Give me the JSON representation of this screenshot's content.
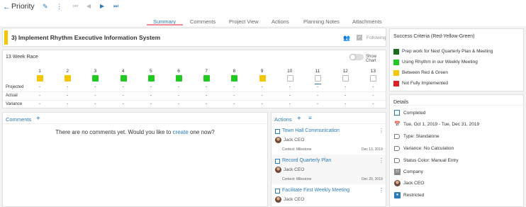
{
  "header": {
    "title": "Priority",
    "back_icon": "arrow-left-icon",
    "edit_icon": "pencil-icon",
    "more_icon": "kebab-icon",
    "nav_icons": [
      "first-page-icon",
      "previous-icon",
      "next-icon",
      "last-page-icon"
    ]
  },
  "tabs": [
    {
      "label": "Summary",
      "active": true
    },
    {
      "label": "Comments",
      "active": false
    },
    {
      "label": "Project View",
      "active": false
    },
    {
      "label": "Actions",
      "active": false
    },
    {
      "label": "Planning Notes",
      "active": false
    },
    {
      "label": "Attachments",
      "active": false
    }
  ],
  "goal": {
    "title": "3) Implement Rhythm Executive Information System",
    "following_label": "Following",
    "status_color": "#f6c600"
  },
  "race": {
    "title": "13 Week Race",
    "toggle_label": "Show Chart",
    "weeks": [
      {
        "num": "1",
        "status": "yellow"
      },
      {
        "num": "2",
        "status": "yellow"
      },
      {
        "num": "3",
        "status": "green"
      },
      {
        "num": "4",
        "status": "green"
      },
      {
        "num": "5",
        "status": "green"
      },
      {
        "num": "6",
        "status": "green"
      },
      {
        "num": "7",
        "status": "green"
      },
      {
        "num": "8",
        "status": "green"
      },
      {
        "num": "9",
        "status": "yellow"
      },
      {
        "num": "10",
        "status": "empty"
      },
      {
        "num": "11",
        "status": "empty",
        "current": true
      },
      {
        "num": "12",
        "status": "empty"
      },
      {
        "num": "13",
        "status": "empty"
      }
    ],
    "rows": [
      "Projected",
      "Actual",
      "Variance"
    ],
    "placeholder": "-"
  },
  "comments": {
    "title": "Comments",
    "empty_prefix": "There are no comments yet. Would you like to ",
    "empty_link": "create",
    "empty_suffix": " one now?"
  },
  "actions": {
    "title": "Actions",
    "items": [
      {
        "title": "Town Hall Communication",
        "owner": "Jack CEO",
        "context": "Context: Milestone",
        "date": "Dec 13, 2019"
      },
      {
        "title": "Record Quarterly Plan",
        "owner": "Jack CEO",
        "context": "Context: Milestone",
        "date": "Dec 20, 2019"
      },
      {
        "title": "Facilitate First Weekly Meeting",
        "owner": "Jack CEO",
        "context": "",
        "date": ""
      }
    ]
  },
  "criteria": {
    "title": "Success Criteria (Red-Yellow-Green)",
    "items": [
      {
        "label": "Prep work for Next Quarterly Plan & Meeting",
        "color": "#1a6e1a"
      },
      {
        "label": "Using Rhythm in our Weekly Meeting",
        "color": "#22c922"
      },
      {
        "label": "Between Red & Green",
        "color": "#f6c600"
      },
      {
        "label": "Not Fully Implemented",
        "color": "#e02020"
      }
    ]
  },
  "details": {
    "title": "Details",
    "completed": "Completed",
    "dates": "Tue, Oct 1, 2019 - Tue, Dec 31, 2019",
    "type": "Type: Standalone",
    "variance": "Variance: No Calculation",
    "status_color": "Status Color: Manual Entry",
    "company": "Company",
    "owner": "Jack CEO",
    "restricted": "Restricted"
  },
  "colors": {
    "accent": "#2b7bb9",
    "green": "#22c922",
    "yellow": "#f6c600",
    "empty_border": "#bbbbbb"
  }
}
